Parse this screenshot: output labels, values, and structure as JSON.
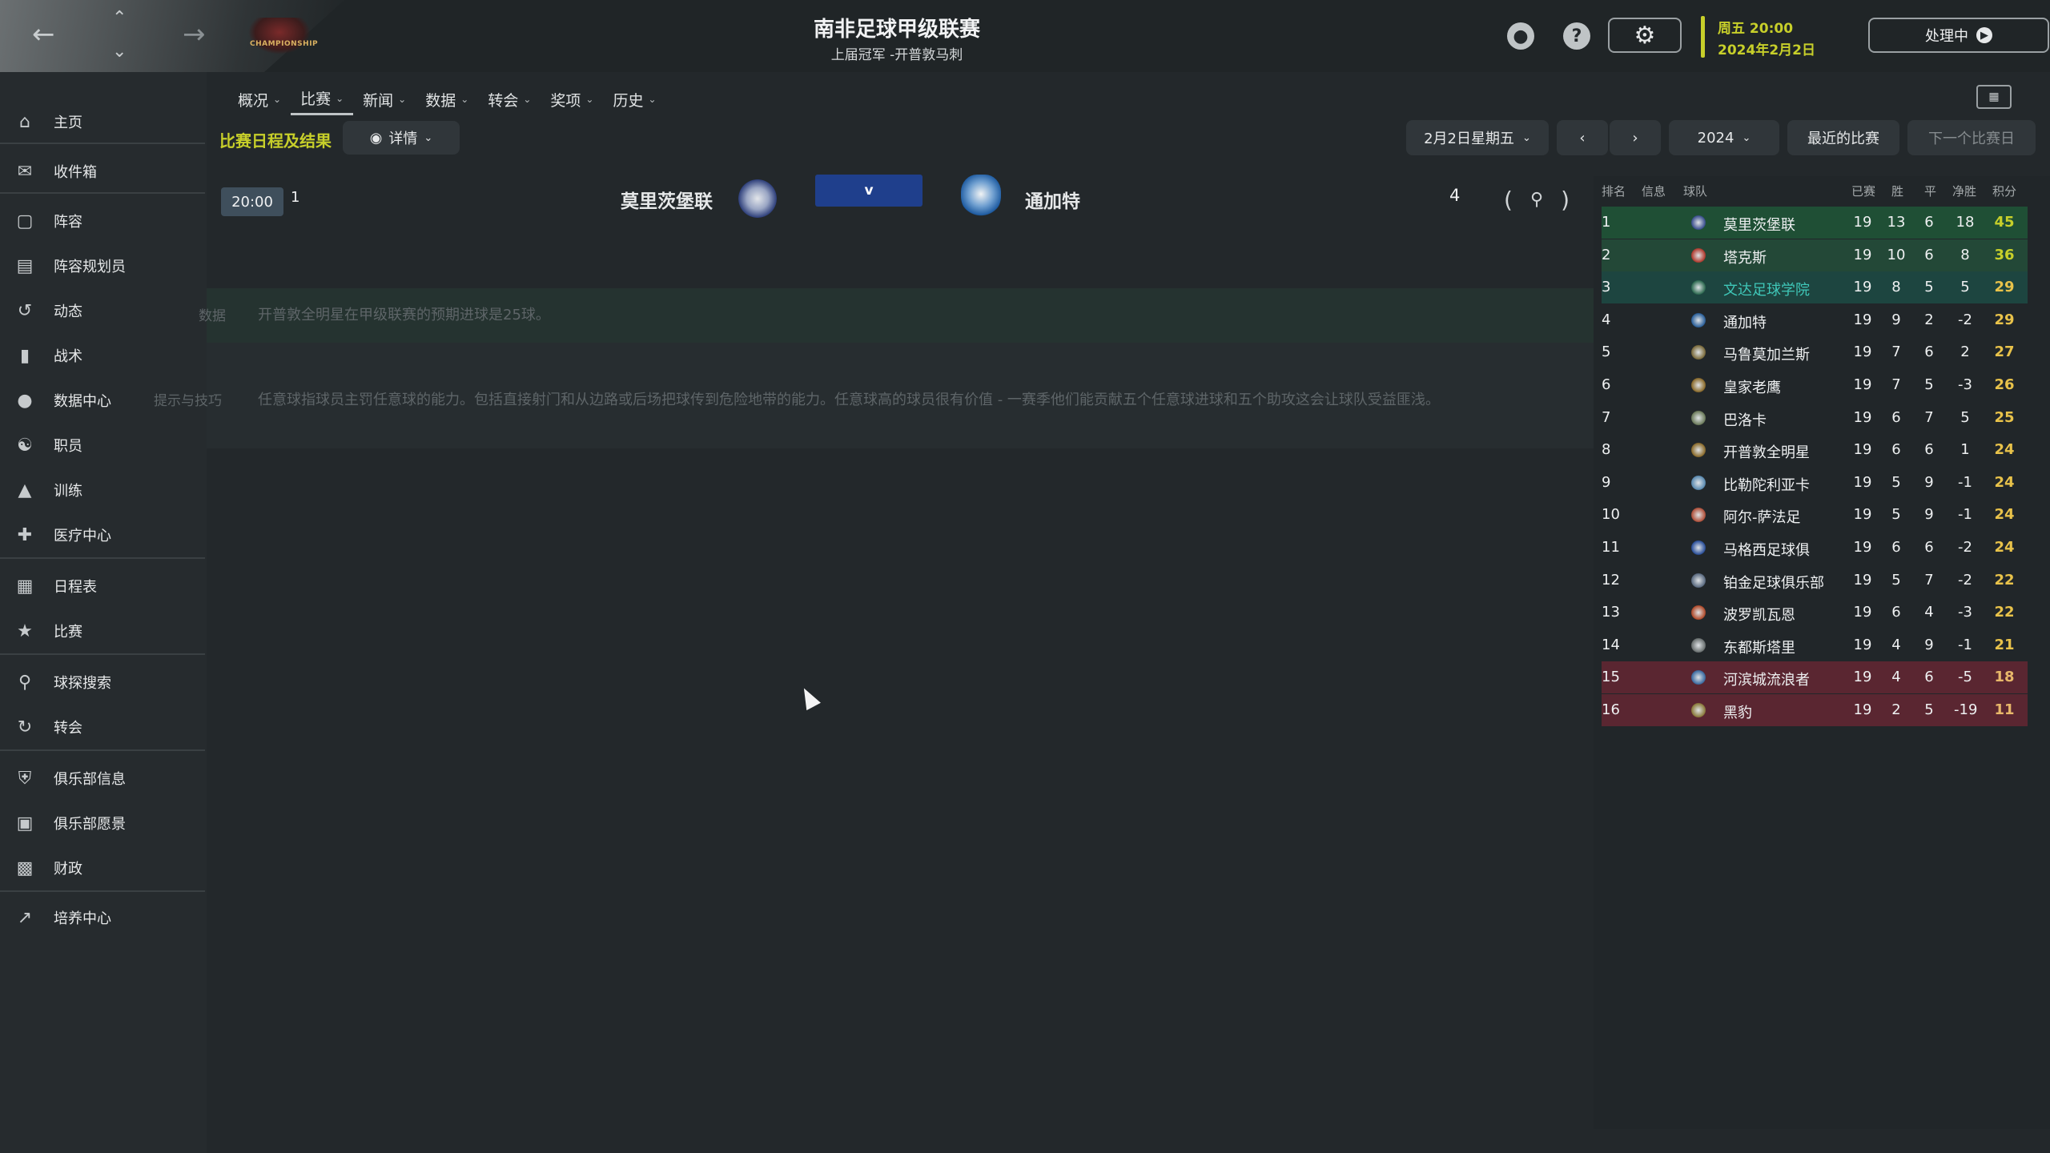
{
  "topbar": {
    "back_icon": "arrow-left",
    "forward_icon": "arrow-right",
    "up_icon": "chevron-up",
    "down_icon": "chevron-down",
    "club_logo_text": "CHAMPIONSHIP",
    "league_title": "南非足球甲级联赛",
    "league_subtitle": "上届冠军 -开普敦马刺",
    "date_line1": "周五 20:00",
    "date_line2": "2024年2月2日",
    "processing_label": "处理中",
    "accent_color": "#c7cf2a"
  },
  "sidebar": {
    "items": [
      {
        "label": "主页",
        "icon": "home-icon"
      },
      {
        "label": "收件箱",
        "icon": "inbox-icon"
      },
      {
        "label": "阵容",
        "icon": "shirt-icon"
      },
      {
        "label": "阵容规划员",
        "icon": "clipboard-icon"
      },
      {
        "label": "动态",
        "icon": "activity-icon"
      },
      {
        "label": "战术",
        "icon": "tactics-icon"
      },
      {
        "label": "数据中心",
        "icon": "data-hub-icon"
      },
      {
        "label": "职员",
        "icon": "staff-icon"
      },
      {
        "label": "训练",
        "icon": "training-icon"
      },
      {
        "label": "医疗中心",
        "icon": "medical-icon"
      },
      {
        "label": "日程表",
        "icon": "calendar-icon"
      },
      {
        "label": "比赛",
        "icon": "trophy-icon"
      },
      {
        "label": "球探搜索",
        "icon": "search-icon"
      },
      {
        "label": "转会",
        "icon": "transfer-icon"
      },
      {
        "label": "俱乐部信息",
        "icon": "shield-icon"
      },
      {
        "label": "俱乐部愿景",
        "icon": "briefcase-icon"
      },
      {
        "label": "财政",
        "icon": "finance-icon"
      },
      {
        "label": "培养中心",
        "icon": "development-icon"
      }
    ]
  },
  "tabs": [
    {
      "label": "概况"
    },
    {
      "label": "比赛"
    },
    {
      "label": "新闻"
    },
    {
      "label": "数据"
    },
    {
      "label": "转会"
    },
    {
      "label": "奖项"
    },
    {
      "label": "历史"
    }
  ],
  "section": {
    "title": "比赛日程及结果",
    "details_label": "详情",
    "date_selector": "2月2日星期五",
    "year_selector": "2024",
    "recent_label": "最近的比赛",
    "next_label": "下一个比赛日"
  },
  "match": {
    "time": "20:00",
    "number": "1",
    "home": "莫里茨堡联",
    "vs": "v",
    "away": "通加特",
    "round": "4"
  },
  "info": {
    "data_label": "数据",
    "data_text": "开普敦全明星在甲级联赛的预期进球是25球。",
    "tips_label": "提示与技巧",
    "tips_text": "任意球指球员主罚任意球的能力。包括直接射门和从边路或后场把球传到危险地带的能力。任意球高的球员很有价值 - 一赛季他们能贡献五个任意球进球和五个助攻这会让球队受益匪浅。"
  },
  "league_table": {
    "headers": {
      "pos": "排名",
      "info": "信息",
      "team": "球队",
      "played": "已赛",
      "won": "胜",
      "drawn": "平",
      "gd": "净胜",
      "pts": "积分"
    },
    "rows": [
      {
        "pos": "1",
        "team": "莫里茨堡联",
        "p": "19",
        "w": "13",
        "d": "6",
        "gd": "18",
        "pts": "45",
        "zone": "promote"
      },
      {
        "pos": "2",
        "team": "塔克斯",
        "p": "19",
        "w": "10",
        "d": "6",
        "gd": "8",
        "pts": "36",
        "zone": "promote2"
      },
      {
        "pos": "3",
        "team": "文达足球学院",
        "p": "19",
        "w": "8",
        "d": "5",
        "gd": "5",
        "pts": "29",
        "zone": "playoff"
      },
      {
        "pos": "4",
        "team": "通加特",
        "p": "19",
        "w": "9",
        "d": "2",
        "gd": "-2",
        "pts": "29",
        "zone": ""
      },
      {
        "pos": "5",
        "team": "马鲁莫加兰斯",
        "p": "19",
        "w": "7",
        "d": "6",
        "gd": "2",
        "pts": "27",
        "zone": ""
      },
      {
        "pos": "6",
        "team": "皇家老鹰",
        "p": "19",
        "w": "7",
        "d": "5",
        "gd": "-3",
        "pts": "26",
        "zone": ""
      },
      {
        "pos": "7",
        "team": "巴洛卡",
        "p": "19",
        "w": "6",
        "d": "7",
        "gd": "5",
        "pts": "25",
        "zone": ""
      },
      {
        "pos": "8",
        "team": "开普敦全明星",
        "p": "19",
        "w": "6",
        "d": "6",
        "gd": "1",
        "pts": "24",
        "zone": ""
      },
      {
        "pos": "9",
        "team": "比勒陀利亚卡",
        "p": "19",
        "w": "5",
        "d": "9",
        "gd": "-1",
        "pts": "24",
        "zone": ""
      },
      {
        "pos": "10",
        "team": "阿尔-萨法足",
        "p": "19",
        "w": "5",
        "d": "9",
        "gd": "-1",
        "pts": "24",
        "zone": ""
      },
      {
        "pos": "11",
        "team": "马格西足球俱",
        "p": "19",
        "w": "6",
        "d": "6",
        "gd": "-2",
        "pts": "24",
        "zone": ""
      },
      {
        "pos": "12",
        "team": "铂金足球俱乐部",
        "p": "19",
        "w": "5",
        "d": "7",
        "gd": "-2",
        "pts": "22",
        "zone": ""
      },
      {
        "pos": "13",
        "team": "波罗凯瓦恩",
        "p": "19",
        "w": "6",
        "d": "4",
        "gd": "-3",
        "pts": "22",
        "zone": ""
      },
      {
        "pos": "14",
        "team": "东都斯塔里",
        "p": "19",
        "w": "4",
        "d": "9",
        "gd": "-1",
        "pts": "21",
        "zone": ""
      },
      {
        "pos": "15",
        "team": "河滨城流浪者",
        "p": "19",
        "w": "4",
        "d": "6",
        "gd": "-5",
        "pts": "18",
        "zone": "relegate"
      },
      {
        "pos": "16",
        "team": "黑豹",
        "p": "19",
        "w": "2",
        "d": "5",
        "gd": "-19",
        "pts": "11",
        "zone": "relegate"
      }
    ]
  }
}
